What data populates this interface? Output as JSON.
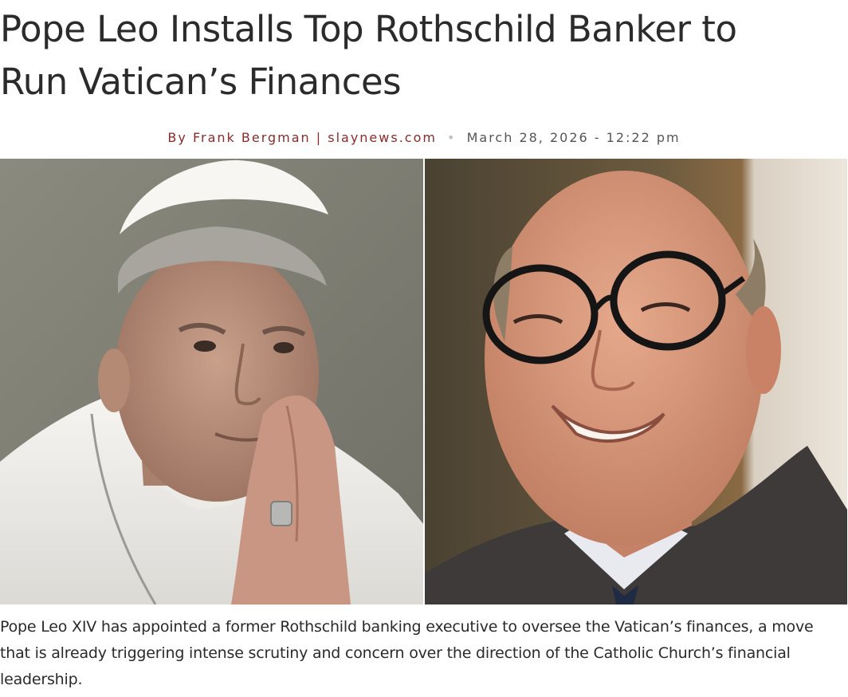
{
  "article": {
    "headline_line1": "Pope Leo Installs Top Rothschild Banker to",
    "headline_line2": "Run Vatican’s Finances",
    "byline": {
      "author_text": "By Frank Bergman | slaynews.com",
      "separator": "•",
      "date_text": "March 28, 2026 - 12:22 pm"
    },
    "lede": "Pope Leo XIV has appointed a former Rothschild banking executive to oversee the Vatican’s finances, a move that is already triggering intense scrutiny and concern over the direction of the Catholic Church’s financial leadership."
  },
  "photos": {
    "left_subject": "pope-praying",
    "right_subject": "smiling-man-glasses"
  }
}
